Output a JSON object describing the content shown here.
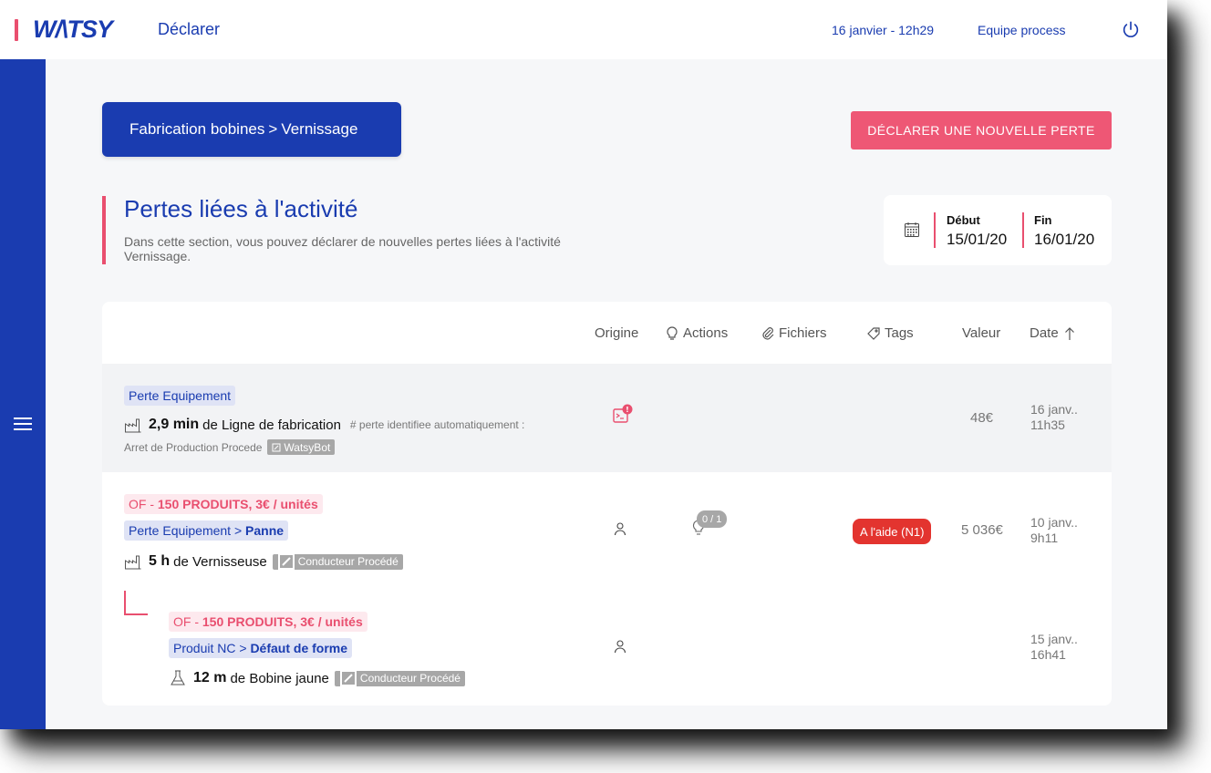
{
  "header": {
    "logo": "W/\\TSY",
    "page_name": "Déclarer",
    "datetime": "16 janvier - 12h29",
    "team": "Equipe process",
    "power_icon": "power-icon"
  },
  "sidebar": {
    "menu_icon": "hamburger-icon"
  },
  "breadcrumb": {
    "part1": "Fabrication bobines",
    "separator": ">",
    "part2": "Vernissage"
  },
  "new_loss_button": "DÉCLARER UNE NOUVELLE PERTE",
  "section": {
    "title": "Pertes liées à l'activité",
    "description": "Dans cette section, vous pouvez déclarer de nouvelles pertes liées à l'activité Vernissage."
  },
  "date_range": {
    "start_label": "Début",
    "start_value": "15/01/20",
    "end_label": "Fin",
    "end_value": "16/01/20"
  },
  "table": {
    "columns": {
      "origine": "Origine",
      "actions": "Actions",
      "fichiers": "Fichiers",
      "tags": "Tags",
      "valeur": "Valeur",
      "date": "Date"
    },
    "rows": [
      {
        "category": "Perte Equipement",
        "quantity": "2,9 min",
        "target": "de Ligne de fabrication",
        "comment": "# perte identifiee automatiquement :",
        "comment2": "Arret de Production Procede",
        "author": "WatsyBot",
        "value": "48€",
        "date_line1": "16 janv..",
        "date_line2": "11h35"
      },
      {
        "of_prefix": "OF -",
        "of_detail": "150 PRODUITS, 3€ / unités",
        "category": "Perte Equipement",
        "subcategory": "Panne",
        "quantity": "5 h",
        "target": "de Vernisseuse",
        "author": "Conducteur Procédé",
        "actions_count": "0 / 1",
        "tag": "A l'aide (N1)",
        "value": "5 036€",
        "date_line1": "10 janv..",
        "date_line2": "9h11"
      },
      {
        "of_prefix": "OF -",
        "of_detail": "150 PRODUITS, 3€ / unités",
        "category": "Produit NC",
        "subcategory": "Défaut de forme",
        "quantity": "12 m",
        "target": "de Bobine jaune",
        "author": "Conducteur Procédé",
        "date_line1": "15 janv..",
        "date_line2": "16h41"
      }
    ]
  },
  "colors": {
    "brand_blue": "#1a3cb0",
    "accent_pink": "#ee5775",
    "alert_red": "#e3342f"
  }
}
